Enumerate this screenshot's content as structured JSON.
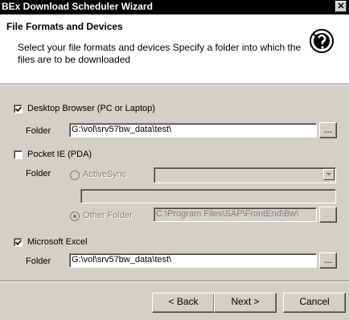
{
  "window": {
    "title": "BEx Download Scheduler Wizard",
    "close_glyph": "✕"
  },
  "header": {
    "title": "File Formats and Devices",
    "description": "Select your file formats and devices Specify a folder into which the files are to be downloaded",
    "icon": "wizard-help-icon"
  },
  "desktop": {
    "label": "Desktop Browser (PC or Laptop)",
    "checked": true,
    "folder_label": "Folder",
    "folder_value": "G:\\vol\\srv57bw_data\\test\\",
    "browse_label": "..."
  },
  "pocket": {
    "label": "Pocket IE (PDA)",
    "checked": false,
    "folder_label": "Folder",
    "activesync_label": "ActiveSync",
    "activesync_value": "",
    "activesync_path": "",
    "other_label": "Other Folder",
    "other_value": "C:\\Program Files\\SAP\\FrontEnd\\Bw\\",
    "browse_label": "..."
  },
  "excel": {
    "label": "Microsoft Excel",
    "checked": true,
    "folder_label": "Folder",
    "folder_value": "G:\\vol\\srv57bw_data\\test\\",
    "browse_label": "..."
  },
  "footer": {
    "back_label": "< Back",
    "next_label": "Next >",
    "cancel_label": "Cancel"
  }
}
